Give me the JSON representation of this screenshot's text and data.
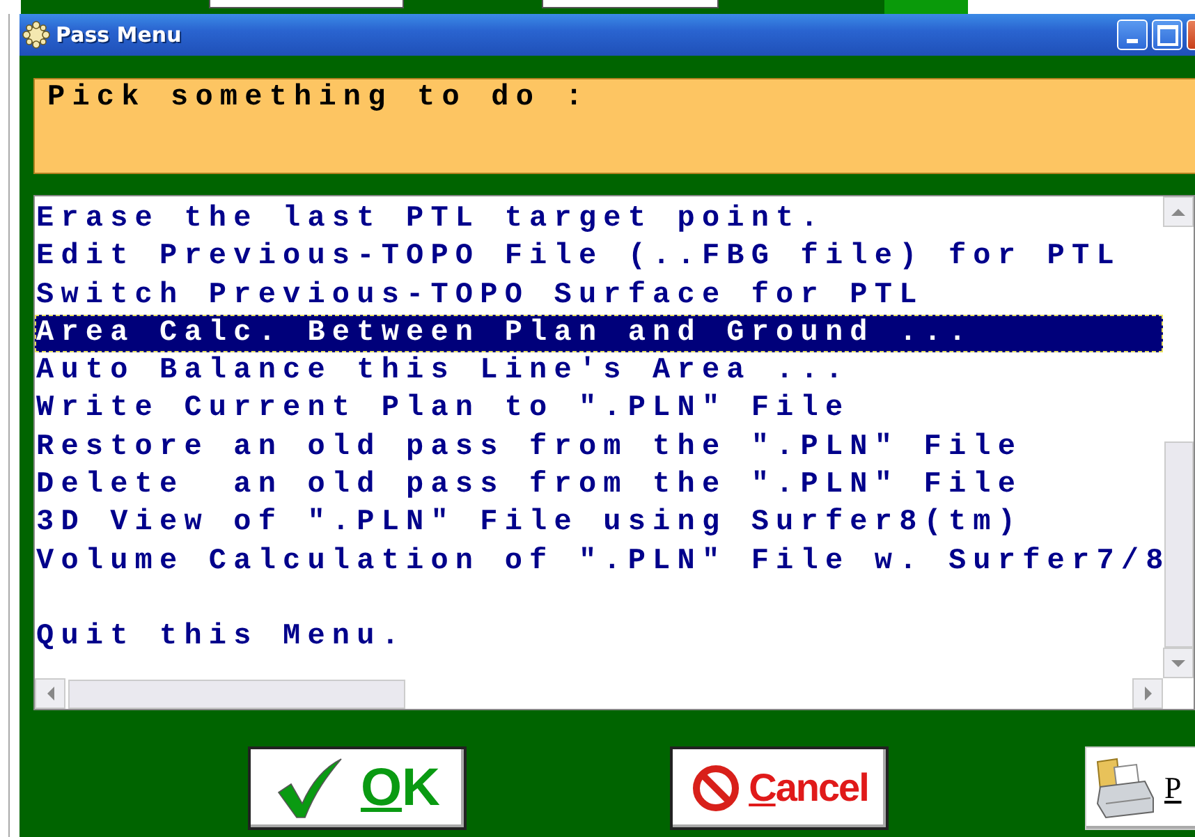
{
  "window": {
    "title": "Pass Menu"
  },
  "prompt": "Pick something to do :",
  "menu": {
    "items": [
      {
        "label": "Erase the last PTL target point.",
        "selected": false
      },
      {
        "label": "Edit Previous-TOPO File (..FBG file) for PTL",
        "selected": false
      },
      {
        "label": "Switch Previous-TOPO Surface for PTL",
        "selected": false
      },
      {
        "label": "Area Calc. Between Plan and Ground ...",
        "selected": true
      },
      {
        "label": "Auto Balance this Line's Area ...",
        "selected": false
      },
      {
        "label": "Write Current Plan to \".PLN\" File",
        "selected": false
      },
      {
        "label": "Restore an old pass from the \".PLN\" File",
        "selected": false
      },
      {
        "label": "Delete  an old pass from the \".PLN\" File",
        "selected": false
      },
      {
        "label": "3D View of \".PLN\" File using Surfer8(tm)",
        "selected": false
      },
      {
        "label": "Volume Calculation of \".PLN\" File w. Surfer7/8",
        "selected": false
      },
      {
        "label": "Quit this Menu.",
        "selected": false,
        "gap_before": true
      }
    ]
  },
  "buttons": [
    {
      "kind": "ok",
      "accel": "O",
      "rest": "K"
    },
    {
      "kind": "cancel",
      "accel": "C",
      "rest": "ancel"
    },
    {
      "kind": "print",
      "accel": "P"
    }
  ]
}
